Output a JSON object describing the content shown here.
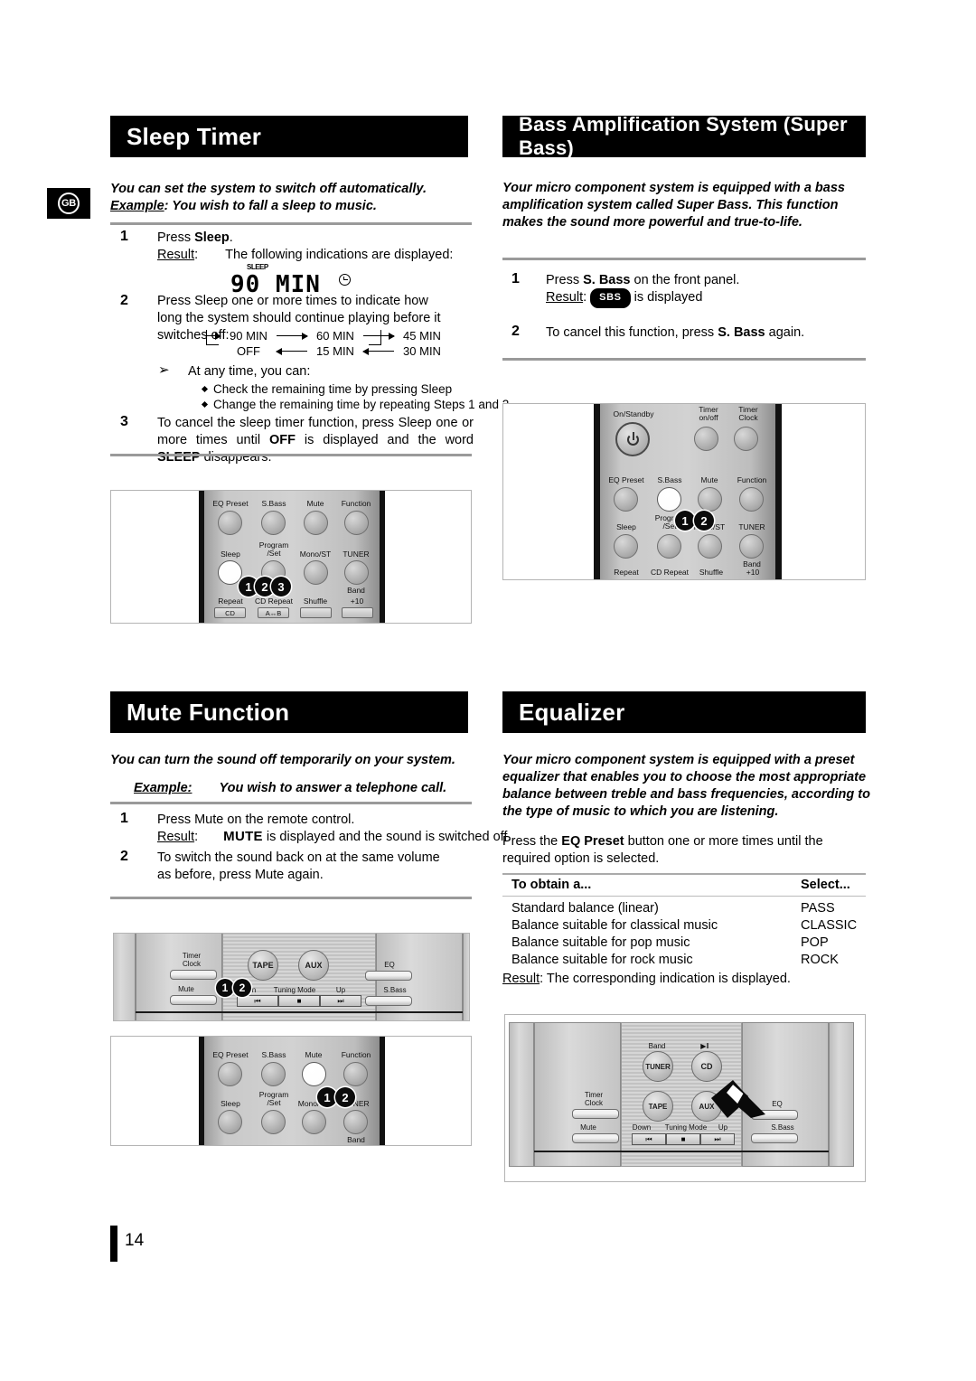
{
  "page": {
    "number": "14",
    "locale_badge": "GB"
  },
  "sections": {
    "sleep_timer": {
      "title": "Sleep Timer",
      "intro_line1": "You can set the system to switch off automatically.",
      "intro_example_label": "Example",
      "intro_example_text": ": You wish to fall a sleep to music.",
      "steps": [
        {
          "num": "1",
          "line1_pre": "Press ",
          "line1_bold": "Sleep",
          "line1_post": ".",
          "result_label": "Result",
          "result_text": "The following indications are displayed:"
        },
        {
          "num": "2",
          "text": "Press Sleep one or more times to indicate how long the system should continue playing before it switches off:"
        },
        {
          "num": "3",
          "text_pre": "To cancel the sleep timer function, press Sleep one or more times until  ",
          "bold1": "OFF",
          "text_mid": " is displayed and the word ",
          "bold2": "SLEEP",
          "text_post": " disappears."
        }
      ],
      "lcd": {
        "sleep_label": "SLEEP",
        "value": "90 MIN",
        "clock_icon": "clock-icon"
      },
      "cycle": {
        "top": [
          "90 MIN",
          "60 MIN",
          "45 MIN"
        ],
        "bottom": [
          "OFF",
          "15 MIN",
          "30 MIN"
        ]
      },
      "tip": {
        "marker": "➢",
        "heading": "At any time, you can:",
        "bullets": [
          "Check the remaining time by pressing Sleep",
          "Change the remaining time by repeating Steps 1 and 2"
        ]
      },
      "remote": {
        "row1_labels": [
          "EQ Preset",
          "S.Bass",
          "Mute",
          "Function"
        ],
        "row2_labels": [
          "Sleep",
          "Program\n/Set",
          "Mono/ST",
          "TUNER"
        ],
        "band_label": "Band",
        "row3_labels": [
          "Repeat",
          "CD Repeat",
          "Shuffle",
          "+10"
        ],
        "row3_buttons": [
          "CD",
          "A↔B",
          "",
          ""
        ],
        "bubbles": [
          "1",
          "2",
          "3"
        ],
        "highlight": "Sleep"
      }
    },
    "super_bass": {
      "title": "Bass Amplification System (Super Bass)",
      "intro": "Your micro component system is equipped with a bass amplification system called Super Bass. This function makes the sound more powerful and true-to-life.",
      "steps": [
        {
          "num": "1",
          "line1_pre": "Press ",
          "line1_bold": "S. Bass",
          "line1_post": " on the front panel.",
          "result_label": "Result",
          "badge": "SBS",
          "result_post": "is displayed"
        },
        {
          "num": "2",
          "text_pre": "To cancel this function, press ",
          "bold": "S. Bass",
          "text_post": " again."
        }
      ],
      "remote": {
        "top_labels": [
          "On/Standby",
          "Timer\non/off",
          "Timer\nClock"
        ],
        "row1_labels": [
          "EQ Preset",
          "S.Bass",
          "Mute",
          "Function"
        ],
        "row2_labels": [
          "Sleep",
          "Program\n/Set",
          "Mono/ST",
          "TUNER"
        ],
        "band_label": "Band",
        "row3_labels": [
          "Repeat",
          "CD Repeat",
          "Shuffle",
          "+10"
        ],
        "bubbles": [
          "1",
          "2"
        ],
        "highlight": "S.Bass"
      }
    },
    "mute": {
      "title": "Mute Function",
      "intro_line1": "You can turn the sound off temporarily on your system.",
      "intro_example_label": "Example:",
      "intro_example_text": "You wish to answer a telephone call.",
      "steps": [
        {
          "num": "1",
          "text": "Press Mute on the remote control.",
          "result_label": "Result",
          "badge": "MUTE",
          "result_post": "is displayed and the sound is switched off."
        },
        {
          "num": "2",
          "text": "To switch the sound back on at the same volume as before, press Mute again."
        }
      ],
      "front_panel": {
        "left_labels": [
          "Timer\nClock",
          "Mute"
        ],
        "knobs": [
          "TAPE",
          "AUX"
        ],
        "tuning_row": {
          "down": "Down",
          "mode": "Tuning Mode",
          "up": "Up"
        },
        "transport": [
          "⏮",
          "■",
          "⏭"
        ],
        "right_labels": [
          "EQ",
          "S.Bass"
        ],
        "bubbles": [
          "1",
          "2"
        ]
      },
      "remote": {
        "row1_labels": [
          "EQ Preset",
          "S.Bass",
          "Mute",
          "Function"
        ],
        "row2_labels": [
          "Sleep",
          "Program\n/Set",
          "Mono/ST",
          "TUNER"
        ],
        "band_label": "Band",
        "bubbles": [
          "1",
          "2"
        ],
        "highlight": "Mute"
      }
    },
    "equalizer": {
      "title": "Equalizer",
      "intro": "Your micro component system is equipped with a preset equalizer that enables you to choose the most appropriate balance between treble and bass frequencies, according to the type of music to which you are listening.",
      "instruction_pre": "Press the ",
      "instruction_bold": "EQ Preset",
      "instruction_post": " button one or more times until the required option is selected.",
      "table": {
        "headers": [
          "To obtain a...",
          "Select..."
        ],
        "rows": [
          [
            "Standard balance (linear)",
            "PASS"
          ],
          [
            "Balance suitable for classical music",
            "CLASSIC"
          ],
          [
            "Balance suitable for pop music",
            "POP"
          ],
          [
            "Balance suitable for rock music",
            "ROCK"
          ]
        ]
      },
      "result_label": "Result",
      "result_text": ": The corresponding indication is displayed.",
      "front_panel": {
        "knob_top_labels": [
          "Band",
          "▶‖"
        ],
        "knobs_top": [
          "TUNER",
          "CD"
        ],
        "knobs_bottom": [
          "TAPE",
          "AUX"
        ],
        "left_labels": [
          "Timer\nClock",
          "Mute"
        ],
        "right_labels": [
          "EQ",
          "S.Bass"
        ],
        "tuning_row": {
          "down": "Down",
          "mode": "Tuning Mode",
          "up": "Up"
        },
        "transport": [
          "⏮",
          "■",
          "⏭"
        ],
        "pointer": "pointer-arrow-icon"
      }
    }
  }
}
